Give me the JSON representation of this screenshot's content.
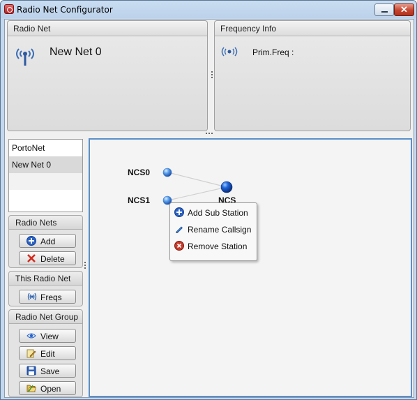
{
  "window": {
    "title": "Radio Net Configurator"
  },
  "radio_net_panel": {
    "header": "Radio Net",
    "net_name": "New Net 0"
  },
  "frequency_panel": {
    "header": "Frequency Info",
    "prim_freq_label": "Prim.Freq",
    "separator": ":"
  },
  "net_list": {
    "items": [
      "PortoNet",
      "New Net 0",
      "",
      ""
    ],
    "selected_index": 1
  },
  "groups": {
    "radio_nets": {
      "header": "Radio Nets",
      "add": "Add",
      "delete": "Delete"
    },
    "this_radio_net": {
      "header": "This Radio Net",
      "freqs": "Freqs"
    },
    "radio_net_group": {
      "header": "Radio Net Group",
      "view": "View",
      "edit": "Edit",
      "save": "Save",
      "open": "Open"
    }
  },
  "canvas": {
    "nodes": [
      {
        "label": "NCS0"
      },
      {
        "label": "NCS1"
      },
      {
        "label": "NCS"
      }
    ]
  },
  "context_menu": {
    "items": [
      "Add Sub Station",
      "Rename Callsign",
      "Remove Station"
    ]
  },
  "colors": {
    "canvas_border": "#5b8fc9",
    "node_blue": "#2f6fd6",
    "remove_red": "#c93a2a"
  }
}
